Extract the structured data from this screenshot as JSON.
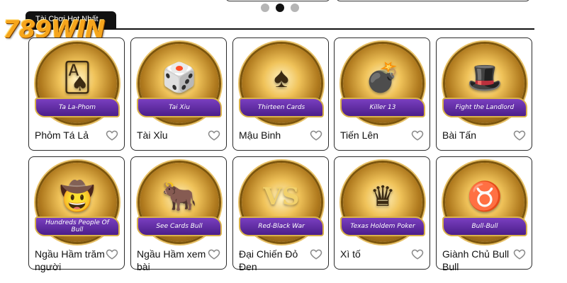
{
  "header": {
    "logo_text": "789WIN",
    "section_title": "Tài Chơi Hot Nhất"
  },
  "carousel": {
    "dots": 3,
    "active_index": 1
  },
  "games": [
    {
      "title": "Phỏm Tá Lả",
      "banner": "Ta La-Phom",
      "icon": "cards-icon",
      "glyph": "🂡"
    },
    {
      "title": "Tài Xỉu",
      "banner": "Tai Xiu",
      "icon": "dice-cup-icon",
      "glyph": "🎲"
    },
    {
      "title": "Mậu Binh",
      "banner": "Thirteen Cards",
      "icon": "revolver-icon",
      "glyph": "♠"
    },
    {
      "title": "Tiến Lên",
      "banner": "Killer 13",
      "icon": "bomb-icon",
      "glyph": "💣"
    },
    {
      "title": "Bài Tấn",
      "banner": "Fight the Landlord",
      "icon": "landlord-icon",
      "glyph": "🎩"
    },
    {
      "title": "Ngầu Hầm trăm người",
      "banner": "Hundreds People Of Bull",
      "icon": "cowboy-hat-icon",
      "glyph": "🤠"
    },
    {
      "title": "Ngầu Hầm xem bài",
      "banner": "See Cards Bull",
      "icon": "bull-mascot-icon",
      "glyph": "🐂"
    },
    {
      "title": "Đại Chiến Đỏ Đen",
      "banner": "Red-Black War",
      "icon": "versus-cards-icon",
      "glyph": "VS"
    },
    {
      "title": "Xì tố",
      "banner": "Texas Holdem Poker",
      "icon": "crown-icon",
      "glyph": "♛"
    },
    {
      "title": "Giành Chủ Bull Bull",
      "banner": "Bull-Bull",
      "icon": "golden-bull-icon",
      "glyph": "♉"
    }
  ]
}
